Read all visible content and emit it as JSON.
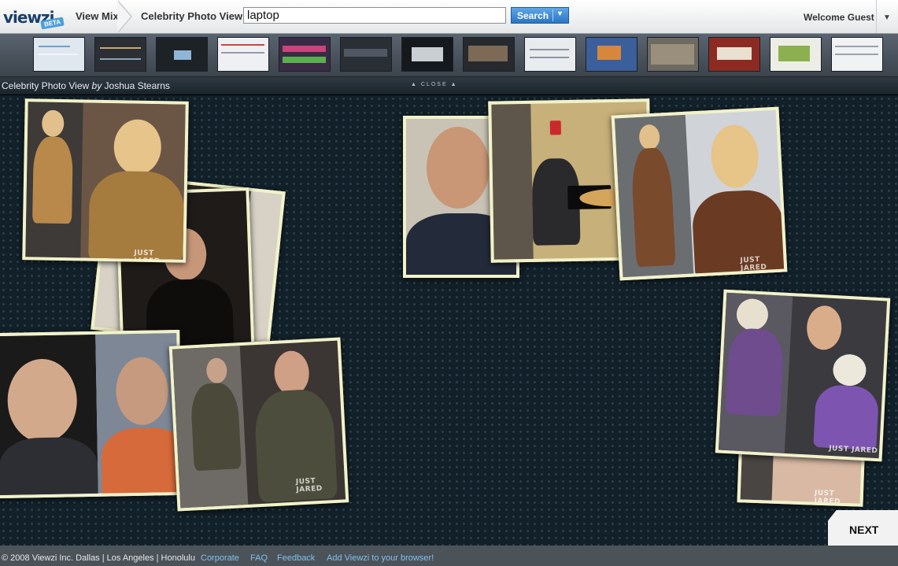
{
  "app": {
    "logo": "viewzi",
    "badge": "BETA"
  },
  "header": {
    "view_mix": "View Mix",
    "current_view": "Celebrity Photo View",
    "search_value": "laptop",
    "search_button": "Search",
    "welcome": "Welcome Guest"
  },
  "titlebar": {
    "view_name": "Celebrity Photo View",
    "by": "by",
    "author": "Joshua Stearns",
    "close": "CLOSE"
  },
  "watermark": "JUST JARED",
  "next": "NEXT",
  "footer": {
    "copyright": "© 2008 Viewzi Inc. Dallas | Los Angeles | Honolulu",
    "links": [
      "Corporate",
      "FAQ",
      "Feedback",
      "Add Viewzi to your browser!"
    ]
  },
  "colors": {
    "accent": "#2a76c4",
    "link": "#7fc1f2",
    "photo_border": "#f1f2c9"
  },
  "icons": [
    "search-dropdown-icon",
    "user-menu-icon",
    "close-arrow-icon"
  ]
}
